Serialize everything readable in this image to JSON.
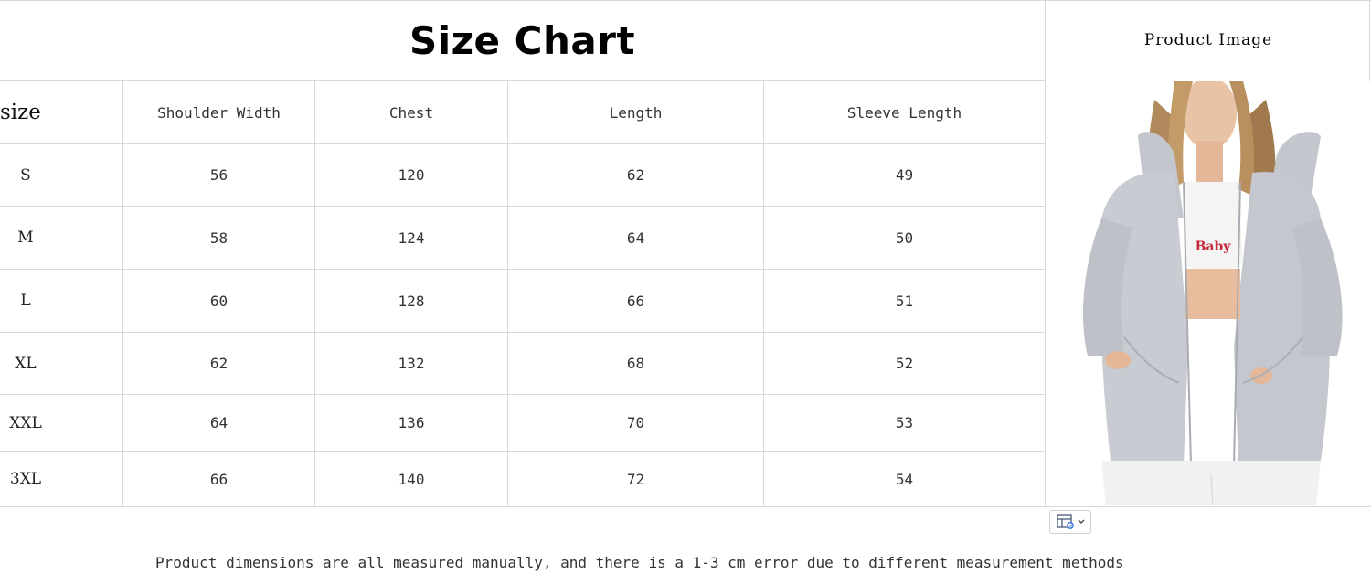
{
  "title": "Size Chart",
  "product_image_title": "Product Image",
  "headers": [
    "size",
    "Shoulder Width",
    "Chest",
    "Length",
    "Sleeve Length"
  ],
  "rows": [
    [
      "S",
      "56",
      "120",
      "62",
      "49"
    ],
    [
      "M",
      "58",
      "124",
      "64",
      "50"
    ],
    [
      "L",
      "60",
      "128",
      "66",
      "51"
    ],
    [
      "XL",
      "62",
      "132",
      "68",
      "52"
    ],
    [
      "XXL",
      "64",
      "136",
      "70",
      "53"
    ],
    [
      "3XL",
      "66",
      "140",
      "72",
      "54"
    ]
  ],
  "footnote": "Product dimensions are all measured manually, and there is a 1-3 cm error due to different measurement methods",
  "product_image": {
    "shirt_text": "Baby"
  },
  "icons": {
    "filter": "table-filter-icon",
    "chevron": "chevron-down-icon"
  },
  "colors": {
    "grid": "#d9d9d9",
    "hoodie": "#c9cbd2",
    "print": "#c8283a"
  }
}
